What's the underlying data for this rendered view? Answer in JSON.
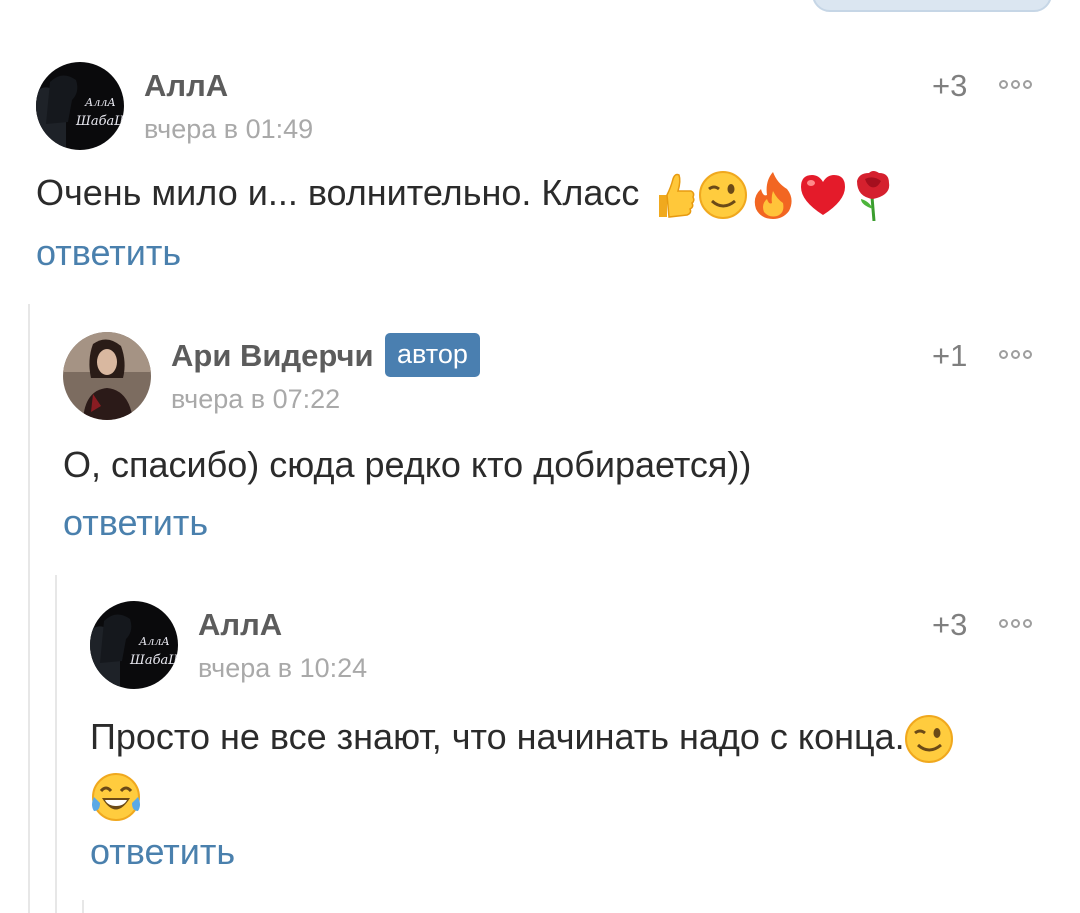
{
  "comments": [
    {
      "author": "АллА",
      "avatar_text_line1": "АллА",
      "avatar_text_line2": "ШабаШ",
      "time": "вчера в 01:49",
      "score": "+3",
      "text": "Очень мило и... волнительно. Класс ",
      "emojis": [
        "thumbs-up",
        "wink",
        "fire",
        "red-heart",
        "rose"
      ],
      "reply_label": "ответить"
    },
    {
      "author": "Ари Видерчи",
      "badge": "автор",
      "time": "вчера в 07:22",
      "score": "+1",
      "text": "О, спасибо) сюда редко кто добирается))",
      "reply_label": "ответить"
    },
    {
      "author": "АллА",
      "avatar_text_line1": "АллА",
      "avatar_text_line2": "ШабаШ",
      "time": "вчера в 10:24",
      "score": "+3",
      "text": "Просто не все знают, что начинать надо с конца.",
      "emojis": [
        "wink",
        "tears-of-joy"
      ],
      "reply_label": "ответить"
    }
  ],
  "colors": {
    "link": "#4a80ad",
    "badge": "#4a7fb0",
    "meta": "#a9a9a9"
  }
}
